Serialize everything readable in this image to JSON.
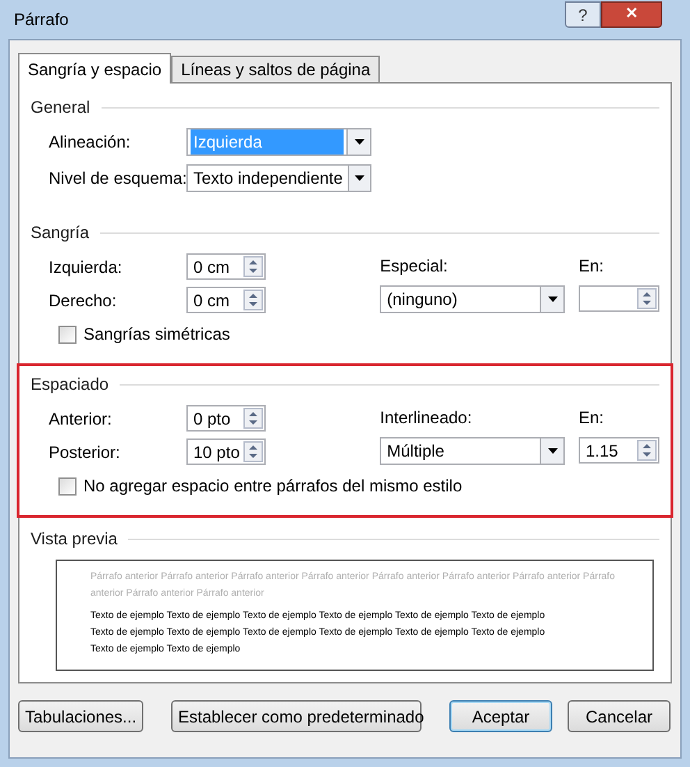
{
  "window": {
    "title": "Párrafo",
    "help": "?",
    "close": "✕"
  },
  "tabs": [
    {
      "label": "Sangría y espacio",
      "selected": true
    },
    {
      "label": "Líneas y saltos de página",
      "selected": false
    }
  ],
  "general": {
    "title": "General",
    "fields": [
      {
        "label": "Alineación:",
        "value": "Izquierda",
        "highlighted": true
      },
      {
        "label": "Nivel de esquema:",
        "value": "Texto independiente",
        "highlighted": false
      }
    ]
  },
  "sections": [
    {
      "title": "Sangría",
      "highlighted": false,
      "fields": [
        {
          "label": "Izquierda:",
          "value": "0 cm"
        },
        {
          "label": "Derecho:",
          "value": "0 cm"
        }
      ],
      "special": {
        "label": "Especial:",
        "value": "(ninguno)"
      },
      "by": {
        "label": "En:"
      },
      "checkbox": {
        "label": "Sangrías simétricas",
        "checked": false
      }
    },
    {
      "title": "Espaciado",
      "highlighted": true,
      "fields": [
        {
          "label": "Anterior:",
          "value": "0 pto"
        },
        {
          "label": "Posterior:",
          "value": "10 pto"
        }
      ],
      "special": {
        "label": "Interlineado:",
        "value": "Múltiple"
      },
      "by": {
        "label": "En:",
        "value": "1.15"
      },
      "checkbox": {
        "label": "No agregar espacio entre párrafos del mismo estilo",
        "checked": false
      }
    }
  ],
  "preview": {
    "title": "Vista previa",
    "previous": "Párrafo anterior Párrafo anterior Párrafo anterior Párrafo anterior Párrafo anterior Párrafo anterior Párrafo anterior Párrafo anterior Párrafo anterior Párrafo anterior",
    "sample": "Texto de ejemplo Texto de ejemplo Texto de ejemplo Texto de ejemplo Texto de ejemplo Texto de ejemplo Texto de ejemplo Texto de ejemplo Texto de ejemplo Texto de ejemplo Texto de ejemplo Texto de ejemplo Texto de ejemplo Texto de ejemplo"
  },
  "buttons": [
    {
      "label": "Tabulaciones...",
      "default": false
    },
    {
      "label": "Establecer como predeterminado",
      "default": false
    },
    {
      "label": "Aceptar",
      "default": true
    },
    {
      "label": "Cancelar",
      "default": false
    }
  ]
}
